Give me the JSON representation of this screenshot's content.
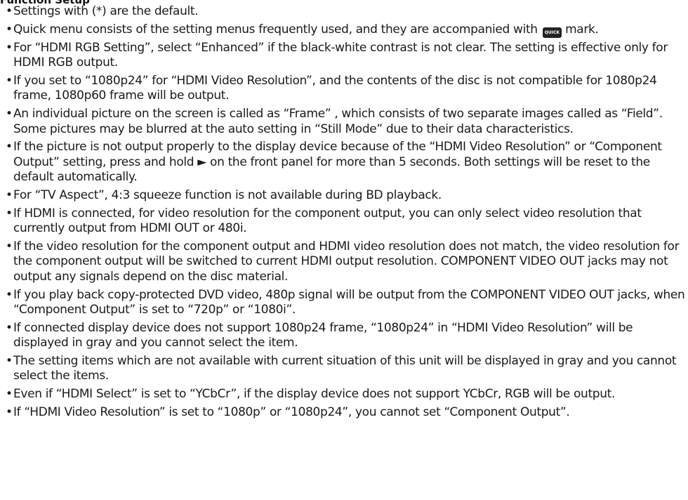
{
  "section": {
    "title": "Function Setup"
  },
  "quick_icon": {
    "label": "QUICK",
    "icon": "quick-menu-icon",
    "color": "#222222"
  },
  "notes": {
    "items": [
      {
        "text": "Settings with (*) are the default."
      },
      {
        "before": "Quick menu consists of the setting menus frequently used, and they are accompanied with ",
        "after": " mark."
      },
      {
        "text": "For “HDMI RGB Setting”, select “Enhanced” if the black-white contrast is not clear. The setting is effective only for HDMI RGB output."
      },
      {
        "text": "If you set to “1080p24” for “HDMI Video Resolution”, and the contents of the disc is not compatible for 1080p24 frame, 1080p60 frame will be output."
      },
      {
        "text": "An individual picture on the screen is called as “Frame” , which consists of two separate images called as “Field”. Some pictures may be blurred at the auto setting in “Still Mode” due to their data characteristics."
      },
      {
        "text": "If the picture is not output properly to the display device because of the “HDMI Video Resolution” or “Component Output” setting, press and hold ► on the front panel for more than 5 seconds. Both settings will be reset to the default automatically."
      },
      {
        "text": "For “TV Aspect”, 4:3 squeeze function is not available during BD playback."
      },
      {
        "text": "If HDMI is connected, for video resolution for the component output, you can only select video resolution that currently output from HDMI OUT or 480i."
      },
      {
        "text": "If the video resolution for the component output and HDMI video resolution does not match, the video resolution for the component output will be switched to current HDMI output resolution. COMPONENT VIDEO OUT jacks may not output any signals depend on the disc material."
      },
      {
        "text": "If you play back copy-protected DVD video, 480p signal will be output from the COMPONENT VIDEO OUT jacks, when “Component Output” is set to “720p” or “1080i”."
      },
      {
        "text": "If connected display device does not support 1080p24 frame, “1080p24” in “HDMI Video Resolution” will be displayed in gray and you cannot select the item."
      },
      {
        "text": "The setting items which are not available with current situation of this unit will be displayed in gray and you cannot select the items."
      },
      {
        "text": "Even if “HDMI Select” is set to “YCbCr”, if the display device does not support YCbCr, RGB will be output."
      },
      {
        "text": "If “HDMI Video Resolution” is set to “1080p” or “1080p24”, you cannot set “Component Output”."
      }
    ]
  }
}
